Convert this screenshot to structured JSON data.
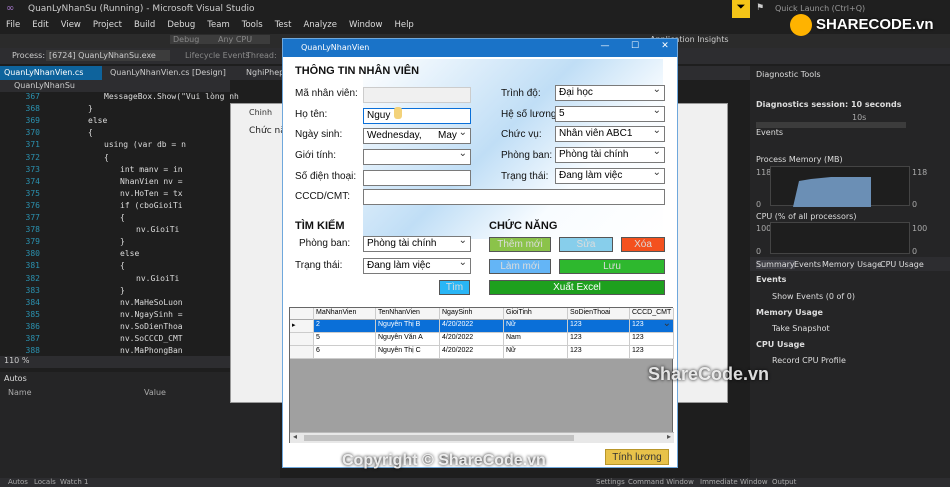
{
  "vs": {
    "title": "QuanLyNhanSu (Running) - Microsoft Visual Studio",
    "menu": [
      "File",
      "Edit",
      "View",
      "Project",
      "Build",
      "Debug",
      "Team",
      "Tools",
      "Test",
      "Analyze",
      "Window",
      "Help"
    ],
    "debug_combo": "Debug",
    "cpu_combo": "Any CPU",
    "quick_launch": "Quick Launch (Ctrl+Q)",
    "app_insights": "Application Insights",
    "process_label": "Process:",
    "process_value": "[6724] QuanLyNhanSu.exe",
    "lifecycle": "Lifecycle Events",
    "thread": "Thread:",
    "tabs": [
      "QuanLyNhanVien.cs",
      "QuanLyNhanVien.cs [Design]",
      "NghiPhep.cs"
    ],
    "tab_back": "Quan",
    "class_combo": "QuanLyNhanSu",
    "zoom": "110 %",
    "autos_title": "Autos",
    "autos_cols": [
      "Name",
      "Value"
    ],
    "bottom_tabs": [
      "Autos",
      "Locals",
      "Watch 1"
    ],
    "bottom_tabs_right": [
      "Settings",
      "Command Window",
      "Immediate Window",
      "Output"
    ]
  },
  "code": [
    {
      "n": "367",
      "t": "MessageBox.Show(\"Vui lòng nh"
    },
    {
      "n": "368",
      "t": "}"
    },
    {
      "n": "369",
      "t": "else"
    },
    {
      "n": "370",
      "t": "{"
    },
    {
      "n": "371",
      "t": "using (var db = n"
    },
    {
      "n": "372",
      "t": "{"
    },
    {
      "n": "373",
      "t": "int manv = in"
    },
    {
      "n": "374",
      "t": "NhanVien nv ="
    },
    {
      "n": "375",
      "t": "nv.HoTen = tx"
    },
    {
      "n": "376",
      "t": "if (cboGioiTi"
    },
    {
      "n": "377",
      "t": "{"
    },
    {
      "n": "378",
      "t": "nv.GioiTi"
    },
    {
      "n": "379",
      "t": "}"
    },
    {
      "n": "380",
      "t": "else"
    },
    {
      "n": "381",
      "t": "{"
    },
    {
      "n": "382",
      "t": "nv.GioiTi"
    },
    {
      "n": "383",
      "t": "}"
    },
    {
      "n": "384",
      "t": "nv.MaHeSoLuon"
    },
    {
      "n": "385",
      "t": "nv.NgaySinh ="
    },
    {
      "n": "386",
      "t": "nv.SoDienThoa"
    },
    {
      "n": "387",
      "t": "nv.SoCCCD_CMT"
    },
    {
      "n": "388",
      "t": "nv.MaPhongBan"
    },
    {
      "n": "389",
      "t": "nv.MaTrinhDo"
    }
  ],
  "chinh": {
    "title": "Chinh",
    "menu": "Chức nă"
  },
  "diag": {
    "title": "Diagnostic Tools",
    "session": "Diagnostics session: 10 seconds",
    "tick": "10s",
    "events": "Events",
    "memory": "Process Memory (MB)",
    "mem_top": "118",
    "mem_bottom": "0",
    "cpu": "CPU (% of all processors)",
    "cpu_top": "100",
    "cpu_bottom": "0",
    "subtabs": [
      "Summary",
      "Events",
      "Memory Usage",
      "CPU Usage"
    ],
    "s_events": "Events",
    "s_show_events": "Show Events (0 of 0)",
    "s_memory": "Memory Usage",
    "s_snapshot": "Take Snapshot",
    "s_cpu": "CPU Usage",
    "s_record": "Record CPU Profile"
  },
  "form": {
    "title": "QuanLyNhanVien",
    "section_info": "THÔNG TIN NHÂN VIÊN",
    "lbl_manv": "Mã nhân viên:",
    "lbl_hoten": "Họ tên:",
    "val_hoten": "Nguy",
    "lbl_ngaysinh": "Ngày sinh:",
    "val_ngaysinh_day": "Wednesday,",
    "val_ngaysinh_month": "May",
    "lbl_gioitinh": "Giới tính:",
    "lbl_sdt": "Số điện thoại:",
    "lbl_cccd": "CCCD/CMT:",
    "lbl_trinhdo": "Trình độ:",
    "val_trinhdo": "Đại học",
    "lbl_hesoluong": "Hệ số lương:",
    "val_hesoluong": "5",
    "lbl_chucvu": "Chức vụ:",
    "val_chucvu": "Nhân viên ABC1",
    "lbl_phongban": "Phòng ban:",
    "val_phongban": "Phòng tài chính",
    "lbl_trangthai": "Trạng thái:",
    "val_trangthai": "Đang làm việc",
    "section_search": "TÌM KIẾM",
    "s_lbl_phongban": "Phòng ban:",
    "s_val_phongban": "Phòng tài chính",
    "s_lbl_trangthai": "Trạng thái:",
    "s_val_trangthai": "Đang làm việc",
    "btn_tim": "Tìm",
    "section_func": "CHỨC NĂNG",
    "btn_them": "Thêm mới",
    "btn_sua": "Sửa",
    "btn_xoa": "Xóa",
    "btn_lammoi": "Làm mới",
    "btn_luu": "Lưu",
    "btn_xuat": "Xuất Excel",
    "btn_tinhluong": "Tính lương",
    "colors": {
      "them": "#8bc34a",
      "sua": "#87ceeb",
      "xoa": "#f4511e",
      "lammoi": "#64b5f6",
      "luu": "#2eb82e",
      "xuat": "#1ea01e",
      "tim": "#29b6f6",
      "title": "#1a73c8"
    },
    "grid": {
      "columns": [
        "MaNhanVien",
        "TenNhanVien",
        "NgaySinh",
        "GioiTinh",
        "SoDienThoai",
        "CCCD_CMT"
      ],
      "rows": [
        [
          "2",
          "Nguyễn Thị B",
          "4/20/2022",
          "Nữ",
          "123",
          "123"
        ],
        [
          "5",
          "Nguyễn Văn A",
          "4/20/2022",
          "Nam",
          "123",
          "123"
        ],
        [
          "6",
          "Nguyễn Thị C",
          "4/20/2022",
          "Nữ",
          "123",
          "123"
        ]
      ]
    }
  },
  "watermark": {
    "logo": "SHARECODE.vn",
    "mid": "ShareCode.vn",
    "copyright": "Copyright © ShareCode.vn"
  }
}
